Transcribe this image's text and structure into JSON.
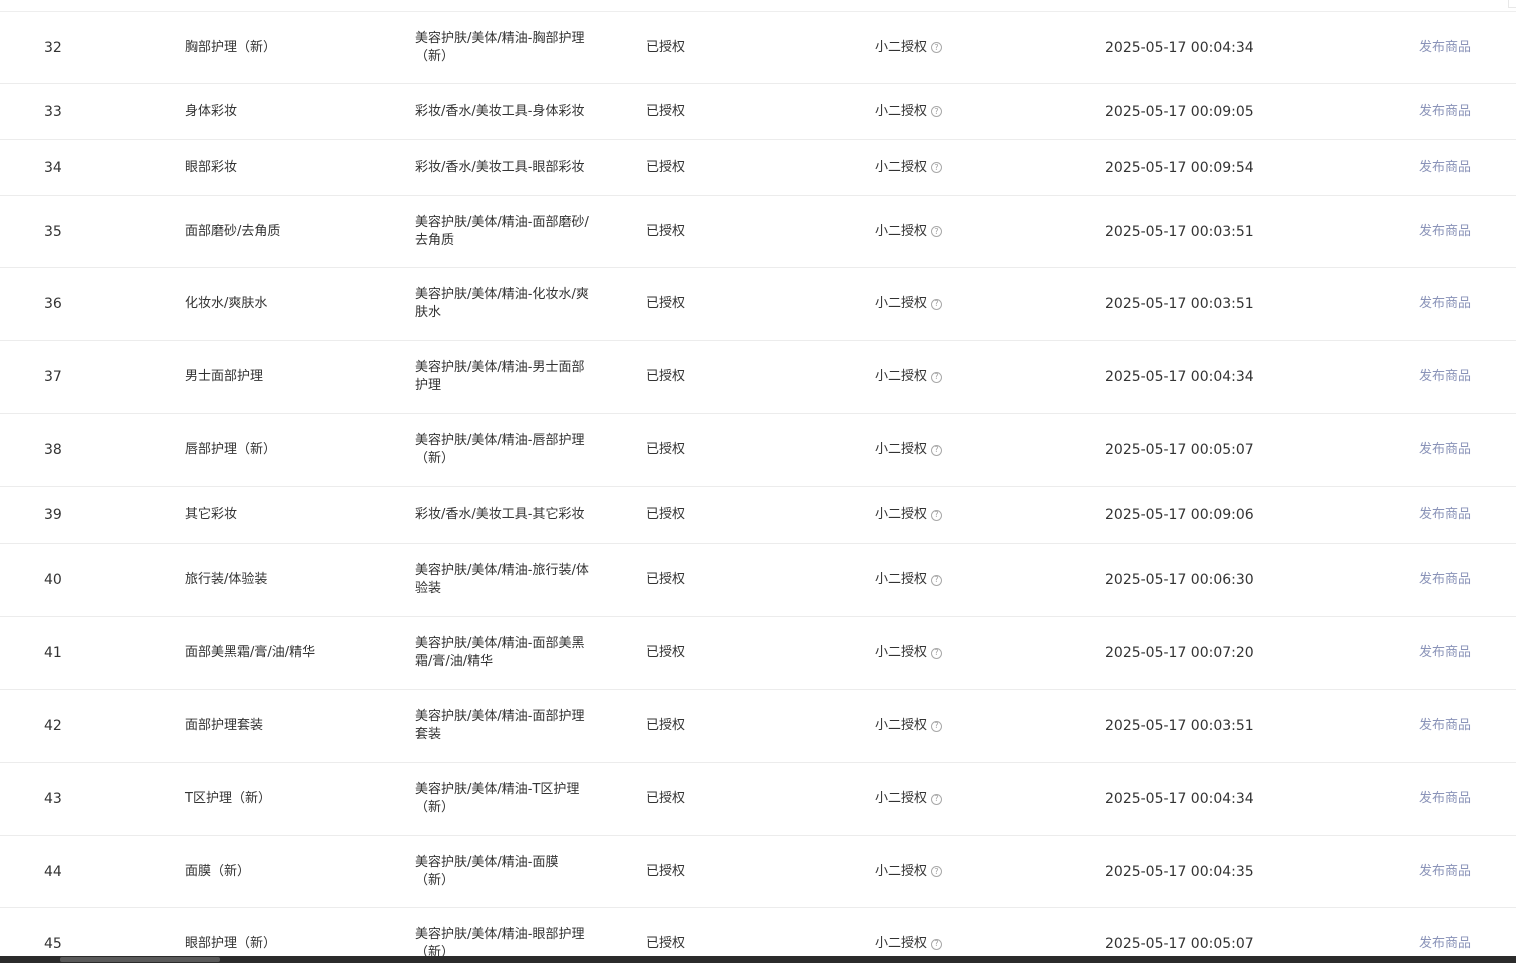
{
  "table": {
    "rows": [
      {
        "index": "32",
        "name": "胸部护理（新）",
        "path": [
          "美容护肤/美体/精油-胸部护理",
          "（新）"
        ],
        "status": "已授权",
        "auth": "小二授权",
        "time": "2025-05-17 00:04:34",
        "action": "发布商品"
      },
      {
        "index": "33",
        "name": "身体彩妆",
        "path": [
          "彩妆/香水/美妆工具-身体彩妆"
        ],
        "status": "已授权",
        "auth": "小二授权",
        "time": "2025-05-17 00:09:05",
        "action": "发布商品"
      },
      {
        "index": "34",
        "name": "眼部彩妆",
        "path": [
          "彩妆/香水/美妆工具-眼部彩妆"
        ],
        "status": "已授权",
        "auth": "小二授权",
        "time": "2025-05-17 00:09:54",
        "action": "发布商品"
      },
      {
        "index": "35",
        "name": "面部磨砂/去角质",
        "path": [
          "美容护肤/美体/精油-面部磨砂/",
          "去角质"
        ],
        "status": "已授权",
        "auth": "小二授权",
        "time": "2025-05-17 00:03:51",
        "action": "发布商品"
      },
      {
        "index": "36",
        "name": "化妆水/爽肤水",
        "path": [
          "美容护肤/美体/精油-化妆水/爽",
          "肤水"
        ],
        "status": "已授权",
        "auth": "小二授权",
        "time": "2025-05-17 00:03:51",
        "action": "发布商品"
      },
      {
        "index": "37",
        "name": "男士面部护理",
        "path": [
          "美容护肤/美体/精油-男士面部",
          "护理"
        ],
        "status": "已授权",
        "auth": "小二授权",
        "time": "2025-05-17 00:04:34",
        "action": "发布商品"
      },
      {
        "index": "38",
        "name": "唇部护理（新）",
        "path": [
          "美容护肤/美体/精油-唇部护理",
          "（新）"
        ],
        "status": "已授权",
        "auth": "小二授权",
        "time": "2025-05-17 00:05:07",
        "action": "发布商品"
      },
      {
        "index": "39",
        "name": "其它彩妆",
        "path": [
          "彩妆/香水/美妆工具-其它彩妆"
        ],
        "status": "已授权",
        "auth": "小二授权",
        "time": "2025-05-17 00:09:06",
        "action": "发布商品"
      },
      {
        "index": "40",
        "name": "旅行装/体验装",
        "path": [
          "美容护肤/美体/精油-旅行装/体",
          "验装"
        ],
        "status": "已授权",
        "auth": "小二授权",
        "time": "2025-05-17 00:06:30",
        "action": "发布商品"
      },
      {
        "index": "41",
        "name": "面部美黑霜/膏/油/精华",
        "path": [
          "美容护肤/美体/精油-面部美黑",
          "霜/膏/油/精华"
        ],
        "status": "已授权",
        "auth": "小二授权",
        "time": "2025-05-17 00:07:20",
        "action": "发布商品"
      },
      {
        "index": "42",
        "name": "面部护理套装",
        "path": [
          "美容护肤/美体/精油-面部护理",
          "套装"
        ],
        "status": "已授权",
        "auth": "小二授权",
        "time": "2025-05-17 00:03:51",
        "action": "发布商品"
      },
      {
        "index": "43",
        "name": "T区护理（新）",
        "path": [
          "美容护肤/美体/精油-T区护理",
          "（新）"
        ],
        "status": "已授权",
        "auth": "小二授权",
        "time": "2025-05-17 00:04:34",
        "action": "发布商品"
      },
      {
        "index": "44",
        "name": "面膜（新）",
        "path": [
          "美容护肤/美体/精油-面膜",
          "（新）"
        ],
        "status": "已授权",
        "auth": "小二授权",
        "time": "2025-05-17 00:04:35",
        "action": "发布商品"
      },
      {
        "index": "45",
        "name": "眼部护理（新）",
        "path": [
          "美容护肤/美体/精油-眼部护理",
          "（新）"
        ],
        "status": "已授权",
        "auth": "小二授权",
        "time": "2025-05-17 00:05:07",
        "action": "发布商品"
      }
    ],
    "help_icon": "question-circle-icon",
    "colors": {
      "action_link": "#8a93b8",
      "text": "#333333",
      "divider": "#ececec"
    }
  }
}
